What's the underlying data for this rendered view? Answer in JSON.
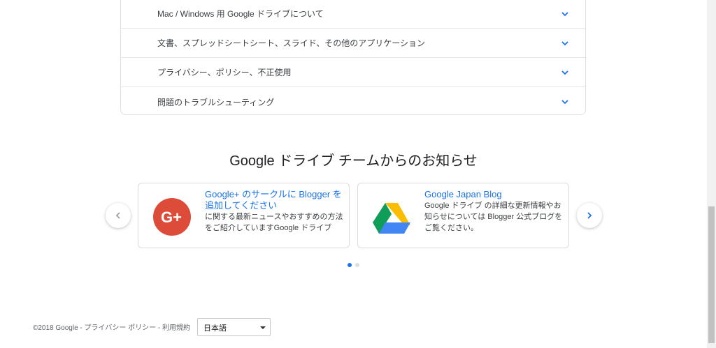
{
  "faq": {
    "items": [
      {
        "label": "Mac / Windows 用 Google ドライブについて"
      },
      {
        "label": "文書、スプレッドシートシート、スライド、その他のアプリケーション"
      },
      {
        "label": "プライバシー、ポリシー、不正使用"
      },
      {
        "label": "問題のトラブルシューティング"
      }
    ]
  },
  "section": {
    "title": "Google ドライブ チームからのお知らせ"
  },
  "cards": [
    {
      "title": "Google+ のサークルに Blogger を追加してください",
      "body": "に関する最新ニュースやおすすめの方法をご紹介していますGoogle ドライブ",
      "icon": "google-plus-icon",
      "color": "#dd4b39"
    },
    {
      "title": "Google Japan Blog",
      "body": "Google ドライブ の詳細な更新情報やお知らせについては Blogger 公式ブログをご覧ください。",
      "icon": "google-drive-icon"
    }
  ],
  "carousel": {
    "pages": 2,
    "active": 0,
    "accent": "#1a73e8"
  },
  "footer": {
    "copyright": "©2018 Google",
    "sep": " - ",
    "privacy": "プライバシー ポリシー",
    "terms": "利用規約",
    "language": "日本語"
  }
}
